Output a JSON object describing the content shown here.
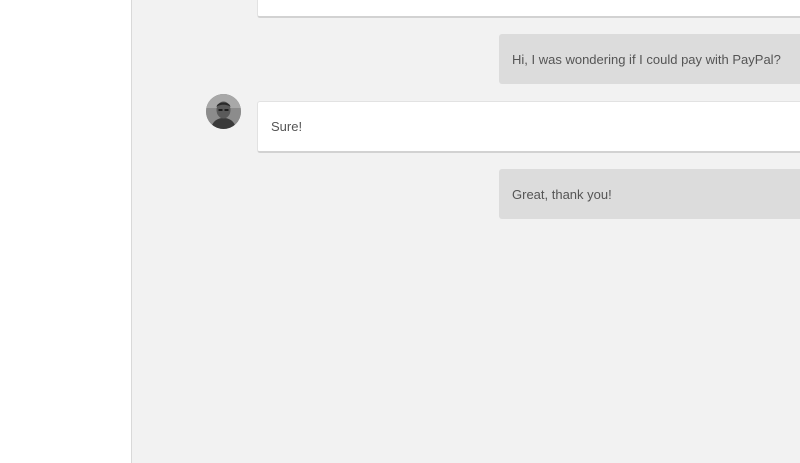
{
  "conversation": {
    "messages": [
      {
        "sender": "agent",
        "text": ""
      },
      {
        "sender": "user",
        "text": "Hi, I was wondering if I could pay with PayPal?"
      },
      {
        "sender": "agent",
        "text": "Sure!",
        "avatar": "agent-avatar-photo"
      },
      {
        "sender": "user",
        "text": "Great, thank you!"
      }
    ]
  },
  "colors": {
    "chat_background": "#f2f2f2",
    "agent_bubble": "#ffffff",
    "user_bubble": "#dcdcdc",
    "text": "#555555"
  }
}
